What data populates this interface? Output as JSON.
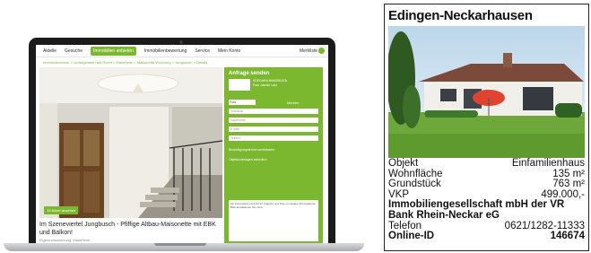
{
  "website": {
    "nav": {
      "items": [
        "Aktelle",
        "Gesuche",
        "Immobilien anbieten",
        "Immobilienbewertung",
        "Service",
        "Mein Konto"
      ],
      "active_index": 2,
      "merkliste": "Merkliste"
    },
    "breadcrumb": "Immobilienbörse > Ludwigshafen am Rhein > Mannheim > Maisonette-Wohnung > Jungbusch > Details",
    "photo_badge": "15 Bilder ansehen",
    "listing_title": "Im Szeneviertel Jungbusch - Pfiffige Altbau-Maisonette mit EBK und Balkon!",
    "listing_subtitle": "Eigentumswohnung, Mannheim",
    "contact_form": {
      "heading": "Anfrage senden",
      "agent_name": "ADEDARA IMMOBILIEN",
      "agent_sub": "Frau Jasmin Lahr",
      "salutation_placeholder": "Frau",
      "bookmark_label": "Merken",
      "fields": [
        "Vorname",
        "Nachname",
        "E-Mail",
        "Telefon"
      ],
      "checkboxes": [
        "Besichtigungstermin vereinbaren",
        "Objektunterlagen anfordern"
      ],
      "message_text": "Ich interessiere mich für Ihr Angebot und bitte um weitere Informationen. Bitte kontaktieren Sie mich."
    },
    "colors": {
      "accent": "#7cb82f",
      "laptop_frame": "#1b1b1d"
    }
  },
  "print_listing": {
    "title": "Edingen-Neckarhausen",
    "rows": [
      {
        "label": "Objekt",
        "value": "Einfamilienhaus"
      },
      {
        "label": "Wohnfläche",
        "value": "135 m²"
      },
      {
        "label": "Grundstück",
        "value": "763 m²"
      },
      {
        "label": "VKP",
        "value": "499.000,-"
      }
    ],
    "agency_line1": "Immobiliengesellschaft mbH der VR",
    "agency_line2": "Bank Rhein-Neckar eG",
    "phone_label": "Telefon",
    "phone_value": "0621/1282-11333",
    "online_id_label": "Online-ID",
    "online_id_value": "146674"
  }
}
